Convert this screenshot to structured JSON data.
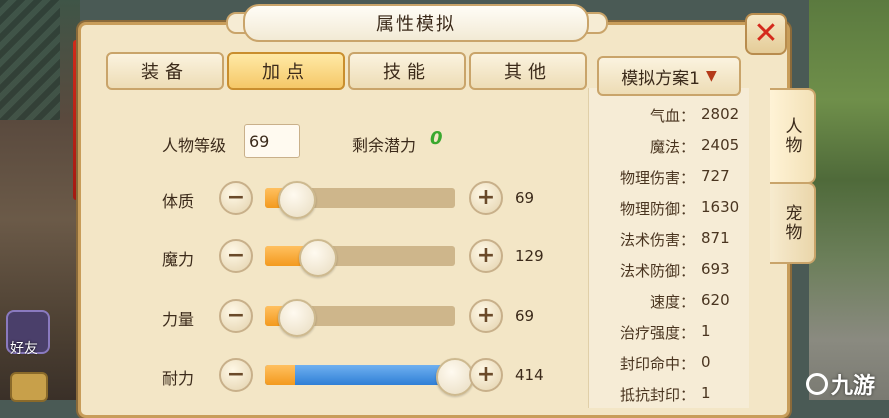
{
  "window": {
    "title": "属性模拟"
  },
  "tabs": [
    {
      "label": "装备",
      "active": false
    },
    {
      "label": "加点",
      "active": true
    },
    {
      "label": "技能",
      "active": false
    },
    {
      "label": "其他",
      "active": false
    }
  ],
  "level": {
    "label": "人物等级",
    "value": "69"
  },
  "potential": {
    "label": "剩余潜力",
    "value": "0"
  },
  "attributes": [
    {
      "name": "体质",
      "value": "69",
      "fill": 0.16,
      "color": "orange"
    },
    {
      "name": "魔力",
      "value": "129",
      "fill": 0.27,
      "color": "orange"
    },
    {
      "name": "力量",
      "value": "69",
      "fill": 0.16,
      "color": "orange"
    },
    {
      "name": "耐力",
      "value": "414",
      "fill": 0.99,
      "color": "blue"
    }
  ],
  "plan": {
    "label": "模拟方案1"
  },
  "stats": [
    {
      "name": "气血",
      "value": "2802"
    },
    {
      "name": "魔法",
      "value": "2405"
    },
    {
      "name": "物理伤害",
      "value": "727"
    },
    {
      "name": "物理防御",
      "value": "1630"
    },
    {
      "name": "法术伤害",
      "value": "871"
    },
    {
      "name": "法术防御",
      "value": "693"
    },
    {
      "name": "速度",
      "value": "620"
    },
    {
      "name": "治疗强度",
      "value": "1"
    },
    {
      "name": "封印命中",
      "value": "0"
    },
    {
      "name": "抵抗封印",
      "value": "1"
    }
  ],
  "side_tabs": [
    {
      "label": "人物"
    },
    {
      "label": "宠物"
    }
  ],
  "game_hud": {
    "friend_label": "好友"
  },
  "watermark": "九游",
  "colors": {
    "accent_orange": "#f39a1e",
    "accent_blue": "#2f7fd6",
    "close_red": "#d42a1c",
    "potential_green": "#3aa82e"
  }
}
